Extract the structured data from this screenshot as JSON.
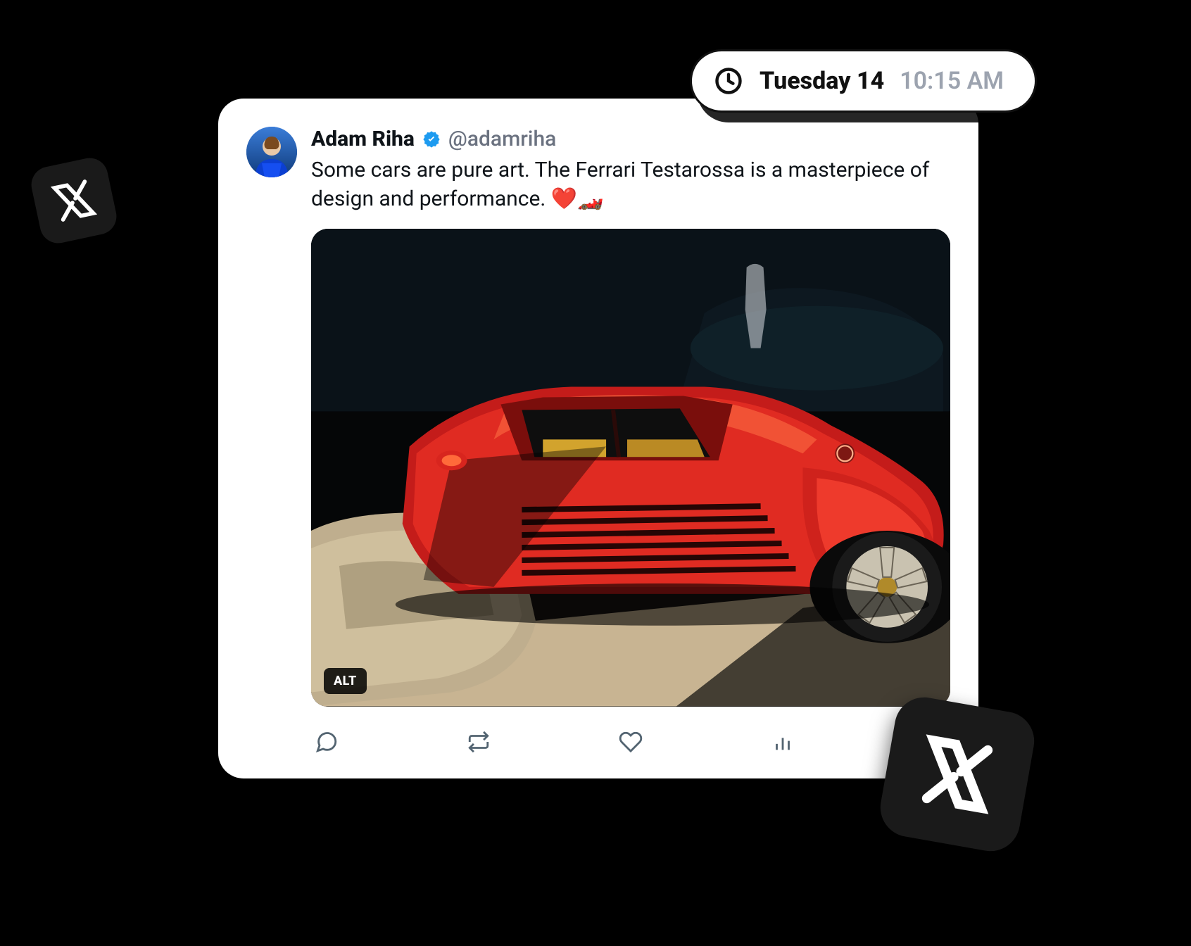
{
  "tweet": {
    "display_name": "Adam Riha",
    "handle": "@adamriha",
    "text": "Some cars are pure art. The Ferrari Testarossa is a masterpiece of design and performance. ❤️🏎️",
    "alt_badge": "ALT"
  },
  "timestamp": {
    "date": "Tuesday 14",
    "time": "10:15 AM"
  },
  "icons": {
    "reply": "reply",
    "retweet": "retweet",
    "like": "like",
    "views": "views",
    "bookmark": "bookmark"
  }
}
